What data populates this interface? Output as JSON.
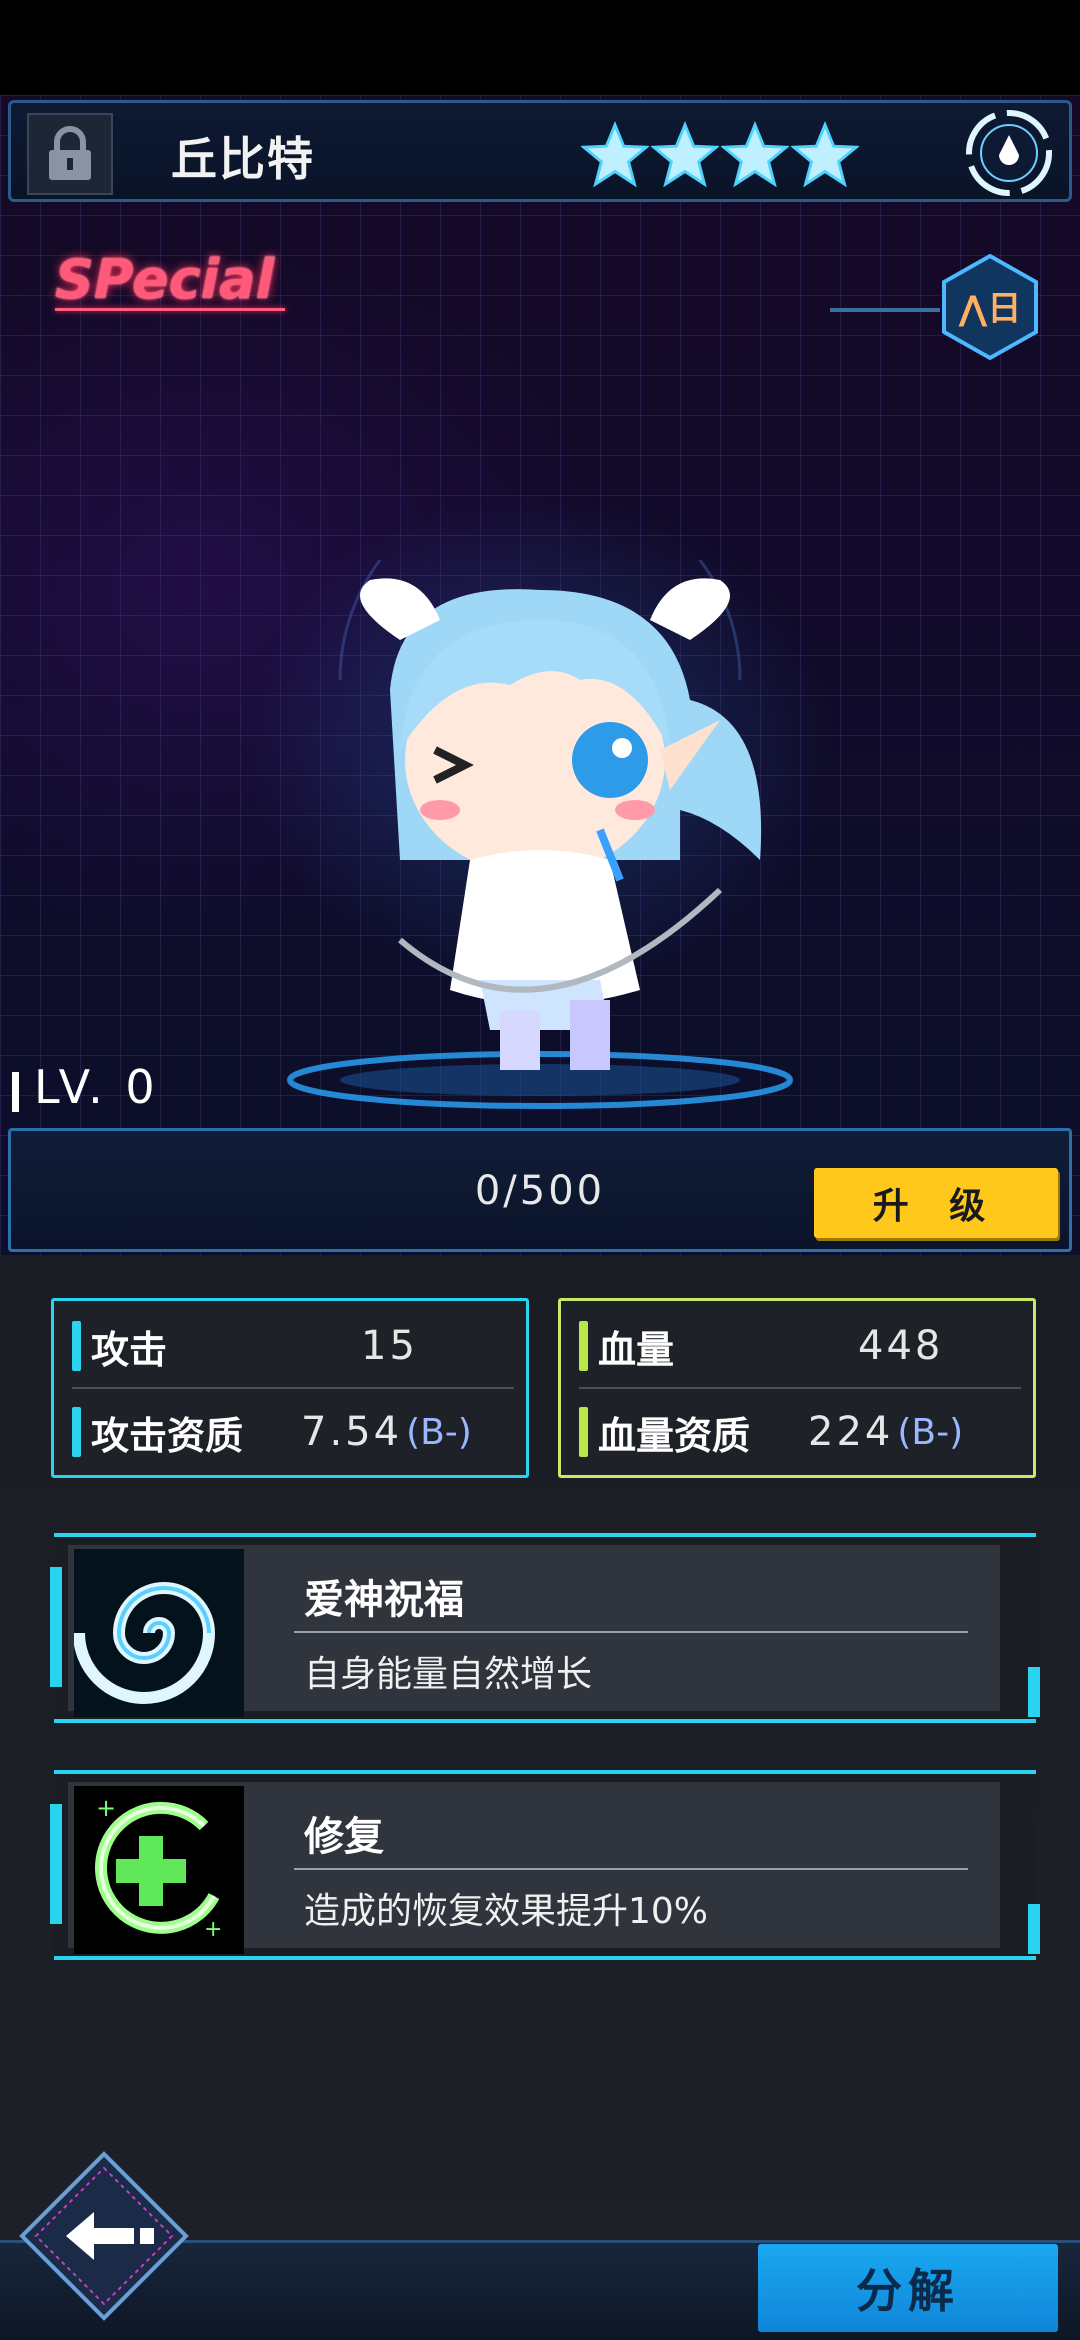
{
  "header": {
    "character_name": "丘比特",
    "star_count": 4,
    "lock_icon": "lock-icon",
    "emblem_icon": "faction-emblem-icon"
  },
  "showcase": {
    "rarity_tag": "SPecial",
    "rank_badge_text": "⋀日"
  },
  "level": {
    "label": "LV. 0",
    "exp_text": "0/500",
    "upgrade_label": "升 级"
  },
  "stats": {
    "attack": {
      "label": "攻击",
      "value": "15"
    },
    "attack_aptitude": {
      "label": "攻击资质",
      "value": "7.54",
      "grade": "(B-)"
    },
    "hp": {
      "label": "血量",
      "value": "448"
    },
    "hp_aptitude": {
      "label": "血量资质",
      "value": "224",
      "grade": "(B-)"
    }
  },
  "skills": [
    {
      "name": "爱神祝福",
      "description": "自身能量自然增长",
      "icon": "swirl-icon"
    },
    {
      "name": "修复",
      "description": "造成的恢复效果提升10%",
      "icon": "heal-plus-icon"
    }
  ],
  "footer": {
    "back_icon": "back-arrow-icon",
    "decompose_label": "分解"
  },
  "colors": {
    "attack_accent": "#2ad3f0",
    "hp_accent": "#c8e86a",
    "upgrade_button": "#ffc81a",
    "decompose_button": "#1aa8f0",
    "special_tag": "#ff5a7a"
  }
}
